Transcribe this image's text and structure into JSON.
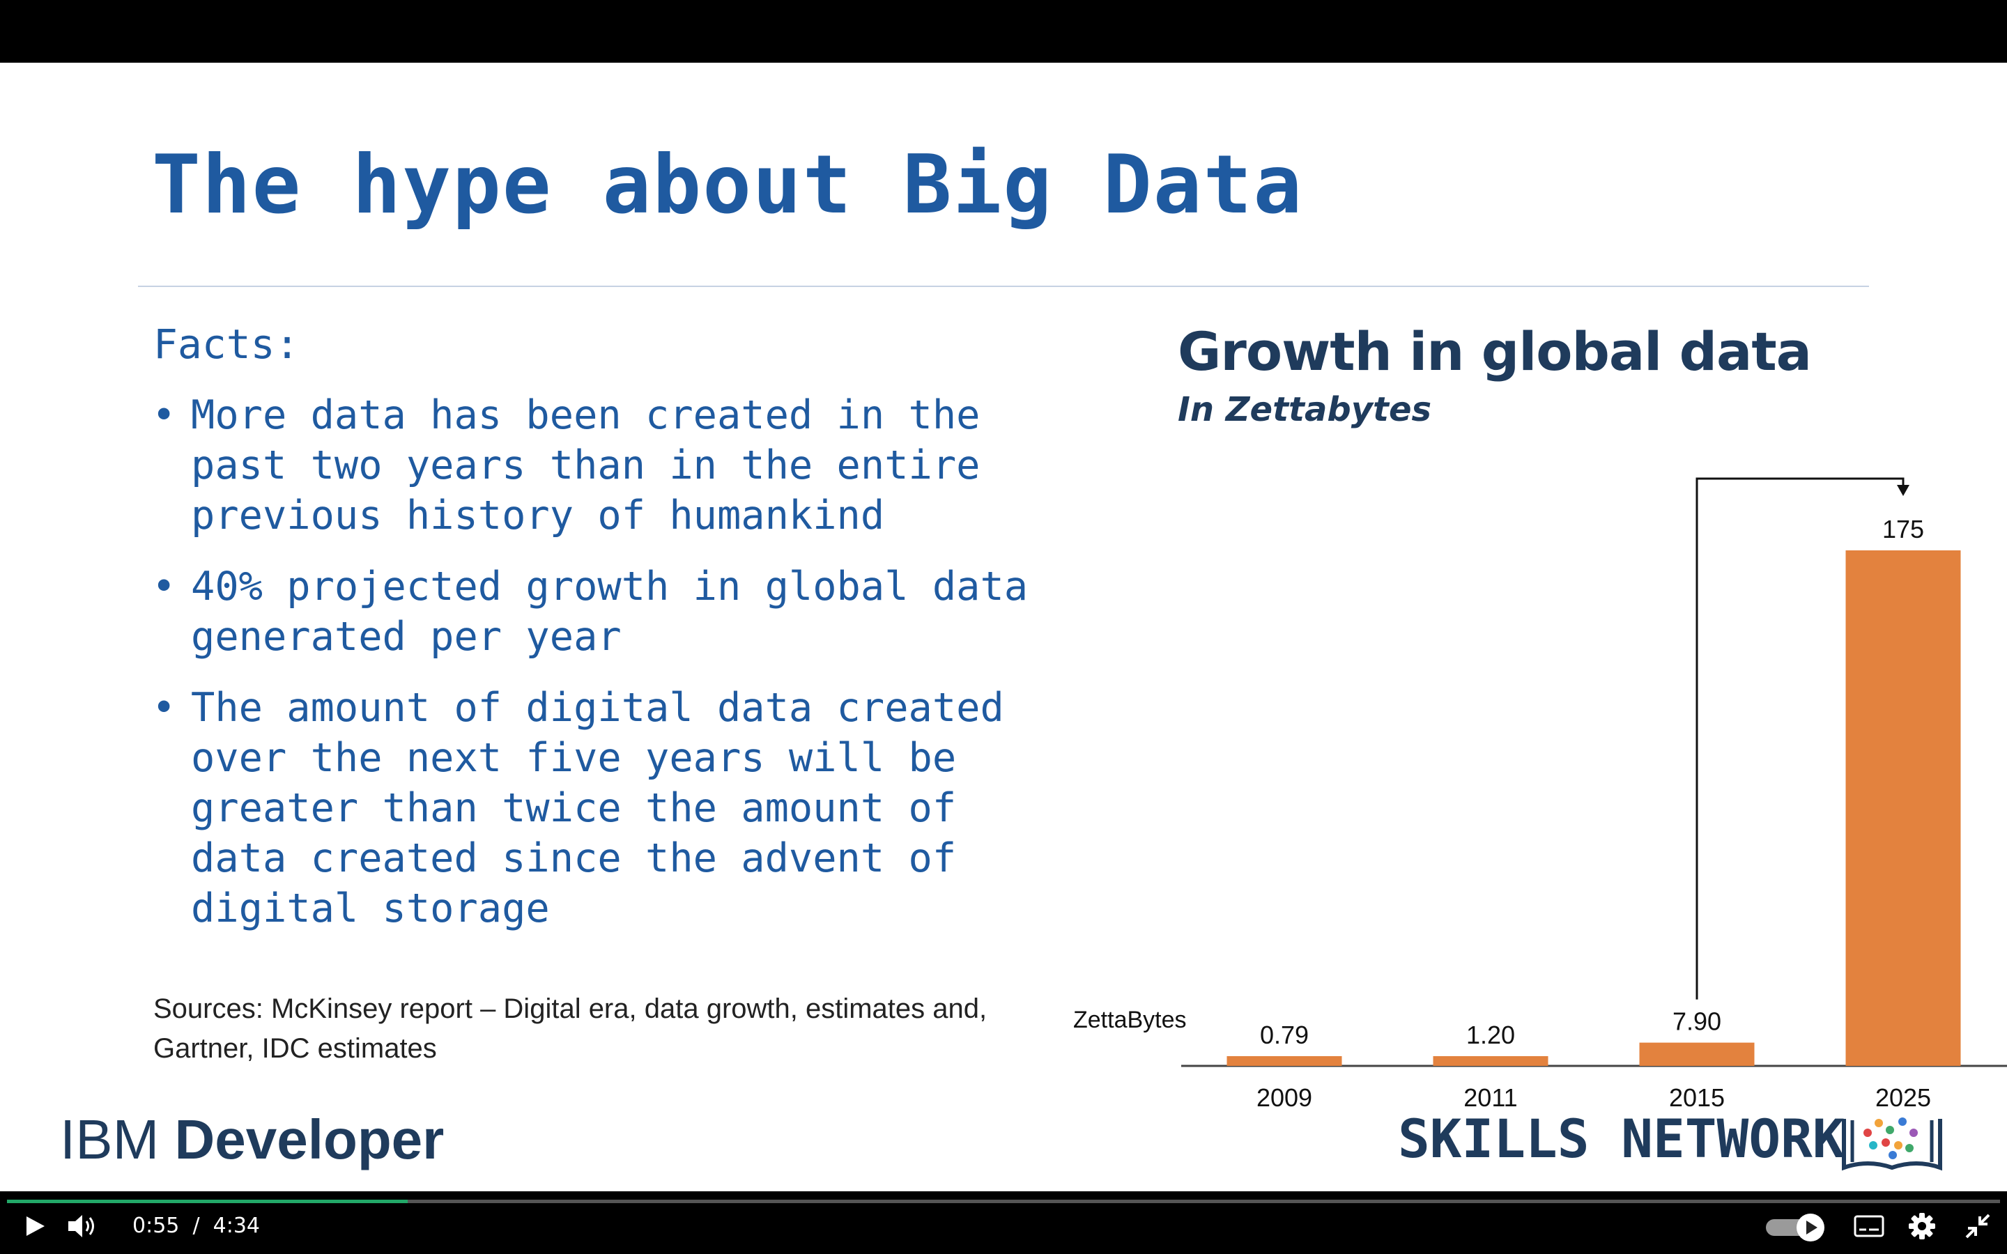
{
  "slide": {
    "title": "The hype about Big Data",
    "facts_heading": "Facts:",
    "bullet_char": "•",
    "facts": [
      "More data has been created in the past two years than in the entire previous history of humankind",
      "40% projected growth in global data generated per year",
      "The amount of digital data created over the next five years will be greater than twice the amount of data created since the advent of digital storage"
    ],
    "sources": "Sources: McKinsey report – Digital era, data growth, estimates and, Gartner, IDC estimates"
  },
  "chart_data": {
    "type": "bar",
    "title": "Growth in global data",
    "subtitle": "In Zettabytes",
    "ylabel": "ZettaBytes",
    "categories": [
      "2009",
      "2011",
      "2015",
      "2025"
    ],
    "values": [
      0.79,
      1.2,
      7.9,
      175
    ],
    "value_labels": [
      "0.79",
      "1.20",
      "7.90",
      "175"
    ],
    "ylim": [
      0,
      175
    ],
    "bar_color": "#e3823e",
    "grid": false,
    "annotation": "arrow from 2015 bar to 2025 bar"
  },
  "branding": {
    "ibm_prefix": "IBM",
    "ibm_name": "Developer",
    "skills_network": "SKILLS NETWORK"
  },
  "player": {
    "current_time": "0:55",
    "separator": "/",
    "duration": "4:34",
    "progress_percent": 20.1,
    "accent_color": "#22a868",
    "icons": [
      "play-icon",
      "volume-icon",
      "autoplay-toggle",
      "captions-icon",
      "settings-icon",
      "exit-fullscreen-icon"
    ]
  }
}
